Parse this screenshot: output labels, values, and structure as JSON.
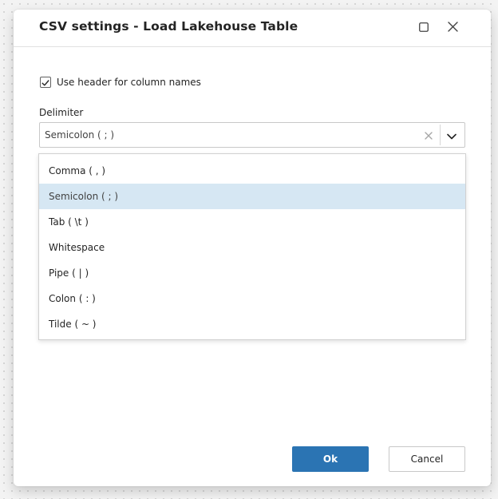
{
  "dialog": {
    "title": "CSV settings - Load Lakehouse Table",
    "maximize_icon": "maximize-icon",
    "close_icon": "close-icon"
  },
  "header_checkbox": {
    "label": "Use header for column names",
    "checked": true
  },
  "delimiter": {
    "label": "Delimiter",
    "selected_value": "Semicolon ( ; )",
    "clear_icon": "clear-icon",
    "chevron_icon": "chevron-down-icon",
    "options": [
      "Comma ( , )",
      "Semicolon ( ; )",
      "Tab ( \\t )",
      "Whitespace",
      "Pipe ( | )",
      "Colon ( : )",
      "Tilde ( ~ )"
    ],
    "selected_index": 1
  },
  "footer": {
    "ok_label": "Ok",
    "cancel_label": "Cancel"
  },
  "colors": {
    "primary": "#2b74b3",
    "selected_option_bg": "#d6e7f3"
  }
}
